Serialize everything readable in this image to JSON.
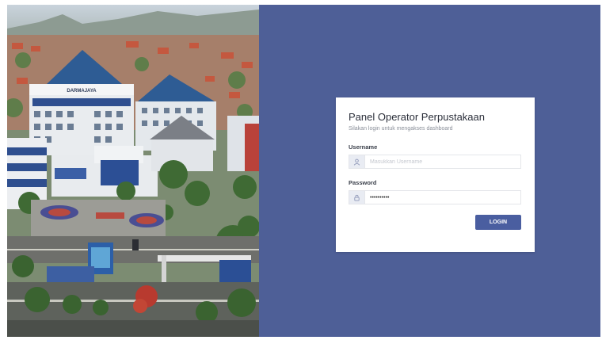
{
  "campus_photo": {
    "signage": "DARMAJAYA"
  },
  "login_card": {
    "title": "Panel Operator Perpustakaan",
    "subtitle": "Silakan login untuk mengakses dashboard",
    "username": {
      "label": "Username",
      "placeholder": "Masukkan Username",
      "icon": "user-icon"
    },
    "password": {
      "label": "Password",
      "value": "••••••••••",
      "icon": "lock-icon"
    },
    "login_label": "LOGIN"
  },
  "colors": {
    "panel_background": "#4e5f97",
    "button": "#4a5ea0",
    "card": "#ffffff"
  }
}
